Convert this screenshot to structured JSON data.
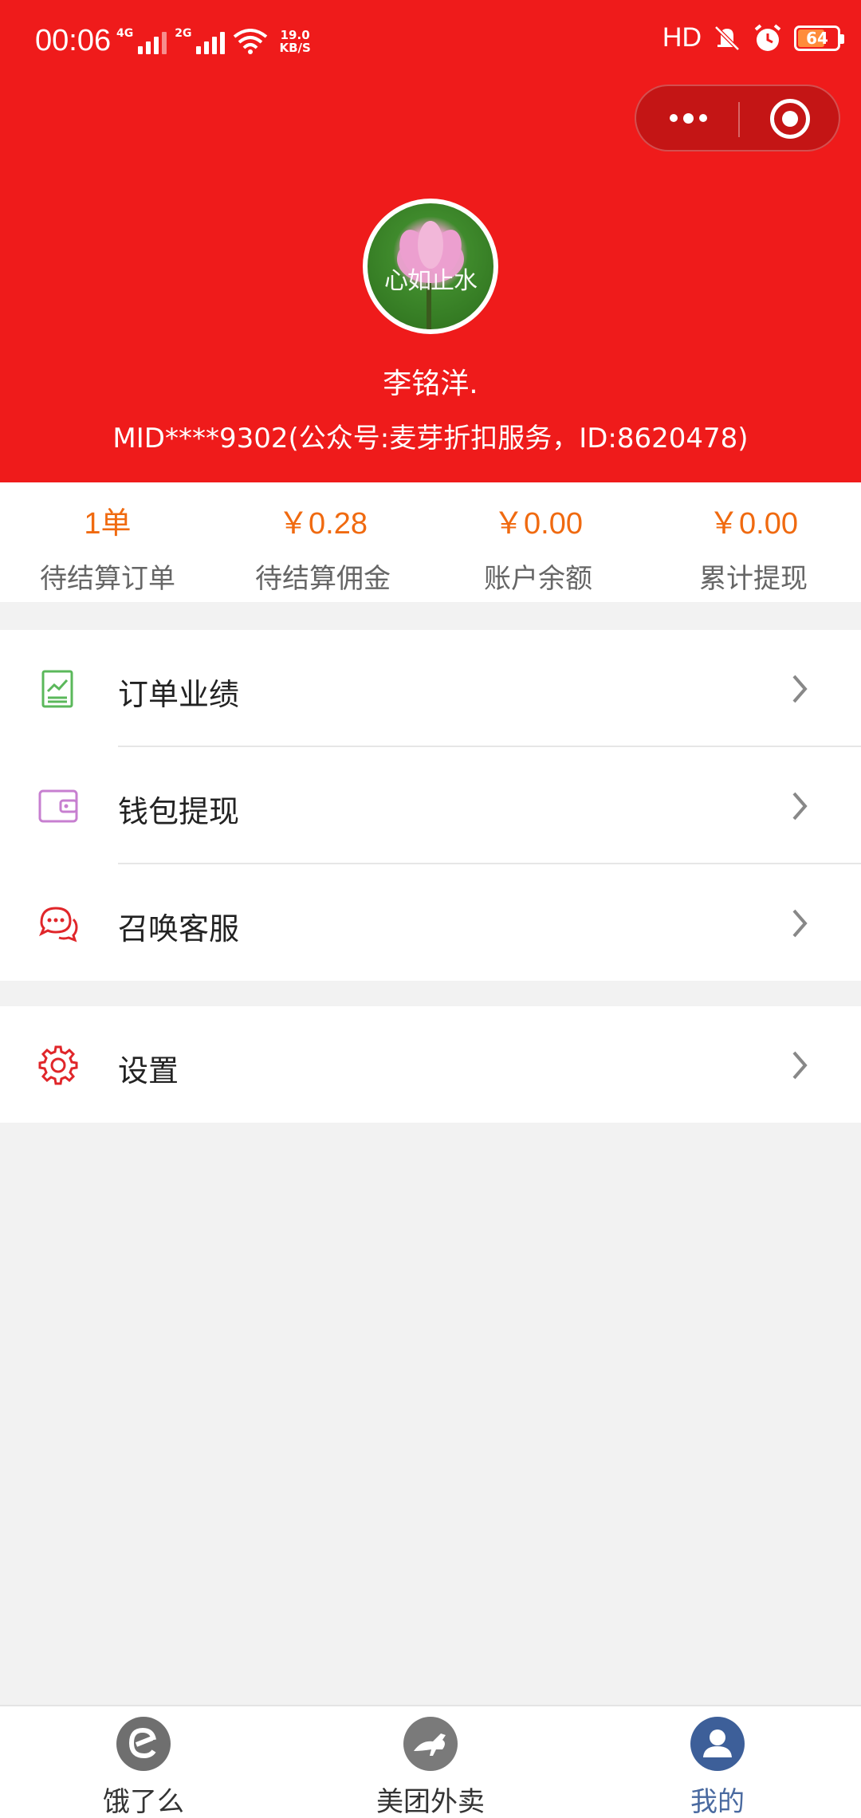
{
  "status_bar": {
    "time": "00:06",
    "net1": "4G",
    "net2": "2G",
    "speed_value": "19.0",
    "speed_unit": "KB/S",
    "hd": "HD",
    "battery": "64"
  },
  "header": {
    "avatar_text": "心如止水",
    "username": "李铭洋.",
    "mid_line": "MID****9302(公众号:麦芽折扣服务，ID:8620478)"
  },
  "stats": [
    {
      "value": "1单",
      "label": "待结算订单"
    },
    {
      "value": "￥0.28",
      "label": "待结算佣金"
    },
    {
      "value": "￥0.00",
      "label": "账户余额"
    },
    {
      "value": "￥0.00",
      "label": "累计提现"
    }
  ],
  "menu": {
    "order_performance": {
      "label": "订单业绩",
      "icon": "chart-icon",
      "color": "#5bb85b"
    },
    "wallet_withdraw": {
      "label": "钱包提现",
      "icon": "wallet-icon",
      "color": "#c77fd0"
    },
    "customer_service": {
      "label": "召唤客服",
      "icon": "chat-icon",
      "color": "#e0262a"
    },
    "settings": {
      "label": "设置",
      "icon": "gear-icon",
      "color": "#e0262a"
    }
  },
  "tabbar": {
    "eleme": "饿了么",
    "meituan": "美团外卖",
    "mine": "我的"
  },
  "colors": {
    "header_bg": "#ef1b1b",
    "accent": "#f06a10",
    "active_tab": "#4a6aa0"
  }
}
